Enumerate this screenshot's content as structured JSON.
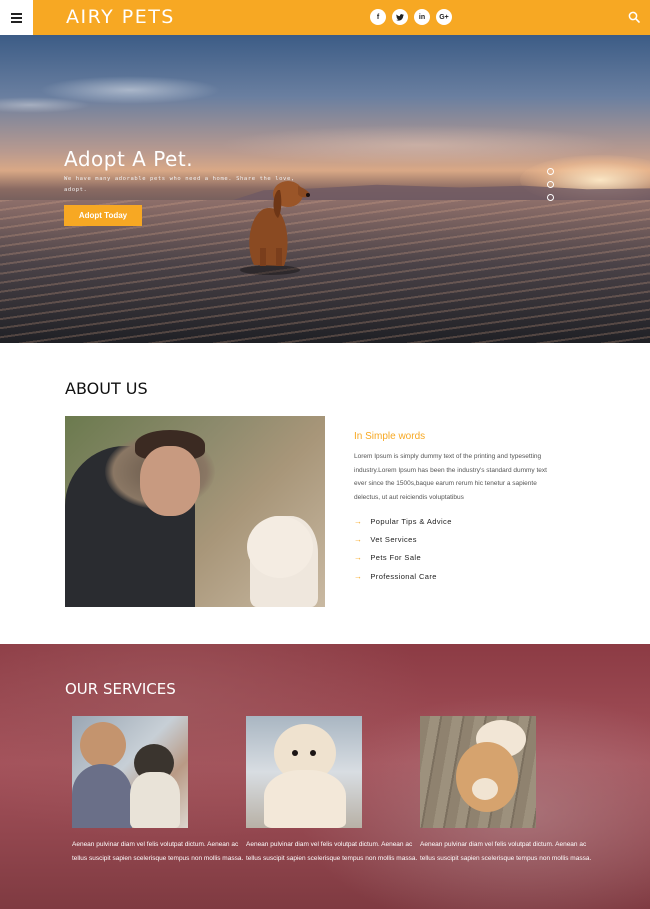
{
  "header": {
    "logo": "AIRY PETS",
    "socials": [
      {
        "label": "f",
        "icon": "facebook-icon"
      },
      {
        "label": "t",
        "icon": "twitter-icon"
      },
      {
        "label": "in",
        "icon": "linkedin-icon"
      },
      {
        "label": "G+",
        "icon": "googleplus-icon"
      }
    ],
    "accent": "#f7a823"
  },
  "hero": {
    "title": "Adopt A Pet.",
    "subtitle": "We have many adorable pets who need a home. Share the love, adopt.",
    "button": "Adopt Today",
    "slides": 3
  },
  "about": {
    "title": "ABOUT US",
    "subtitle": "In Simple words",
    "text": "Lorem Ipsum is simply dummy text of the printing and typesetting industry.Lorem Ipsum has been the industry's standard dummy text ever since the 1500s,baque earum rerum hic tenetur a sapiente delectus, ut aut reiciendis voluptatibus",
    "list": [
      "Popular Tips & Advice",
      "Vet Services",
      "Pets For Sale",
      "Professional Care"
    ]
  },
  "services": {
    "title": "OUR SERVICES",
    "cards": [
      {
        "text": "Aenean pulvinar diam vel felis volutpat dictum. Aenean ac tellus suscipit sapien scelerisque tempus non mollis massa."
      },
      {
        "text": "Aenean pulvinar diam vel felis volutpat dictum. Aenean ac tellus suscipit sapien scelerisque tempus non mollis massa."
      },
      {
        "text": "Aenean pulvinar diam vel felis volutpat dictum. Aenean ac tellus suscipit sapien scelerisque tempus non mollis massa."
      }
    ]
  }
}
